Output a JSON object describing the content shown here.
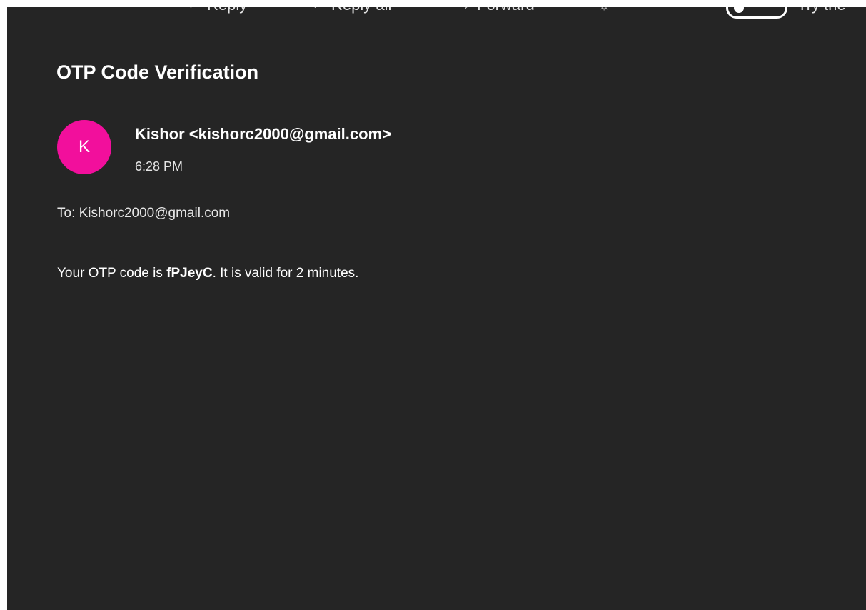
{
  "toolbar": {
    "reply_label": "Reply",
    "reply_all_label": "Reply all",
    "forward_label": "Forward",
    "reply_icon": "reply-icon",
    "reply_all_icon": "reply-all-icon",
    "forward_icon": "forward-icon",
    "more_icon": "lightbulb-icon",
    "try_new_label": "Try the"
  },
  "message": {
    "subject": "OTP Code Verification",
    "avatar_initial": "K",
    "avatar_color": "#f20f9c",
    "sender": "Kishor <kishorc2000@gmail.com>",
    "time": "6:28 PM",
    "to_line": "To: Kishorc2000@gmail.com",
    "body_prefix": "Your OTP code is ",
    "otp_code": "fPJeyC",
    "body_suffix": ". It is valid for 2 minutes."
  },
  "colors": {
    "background": "#252525",
    "text": "#ffffff"
  }
}
